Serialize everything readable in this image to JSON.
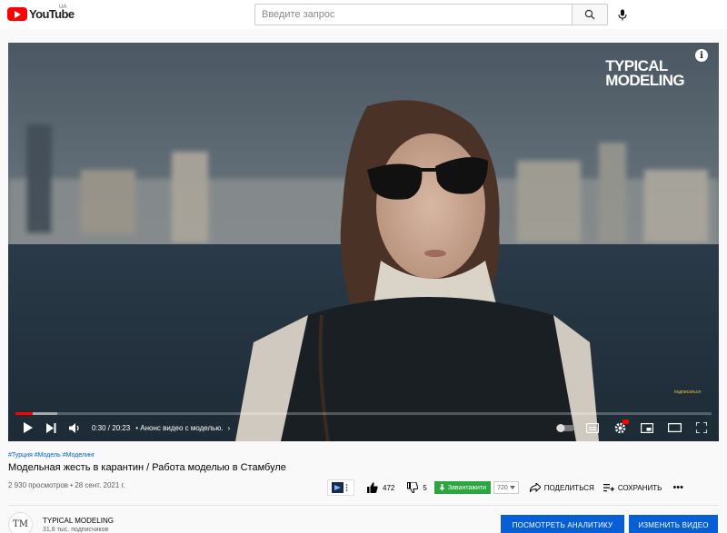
{
  "header": {
    "logo_text": "YouTube",
    "region": "UA",
    "search_placeholder": "Введите запрос"
  },
  "player": {
    "watermark": [
      "TYPICAL",
      "MODELING"
    ],
    "subscribe_watermark": "подписаться",
    "time": "0:30 / 20:23",
    "chapter": "• Анонс видео с моделью.",
    "chapter_arrow": "›",
    "progress_fraction": 0.025,
    "buffered_fraction": 0.06,
    "accent_color": "#ff0000"
  },
  "video": {
    "tags": "#Турция #Модель #Моделинг",
    "title": "Модельная жесть в карантин / Работа моделью в Стамбуле",
    "meta": "2 930 просмотров • 28 сент. 2021 г."
  },
  "actions": {
    "likes": "472",
    "dislikes": "5",
    "download_label": "Завантажити",
    "quality": "720",
    "share_label": "ПОДЕЛИТЬСЯ",
    "save_label": "СОХРАНИТЬ",
    "more_label": "•••"
  },
  "channel": {
    "name": "TYPICAL MODELING",
    "subscribers": "31,8 тыс. подписчиков",
    "avatar_text": "TM",
    "analytics_button": "ПОСМОТРЕТЬ АНАЛИТИКУ",
    "edit_button": "ИЗМЕНИТЬ ВИДЕО"
  },
  "colors": {
    "brand_blue": "#065fd4",
    "download_green": "#2ba640"
  }
}
